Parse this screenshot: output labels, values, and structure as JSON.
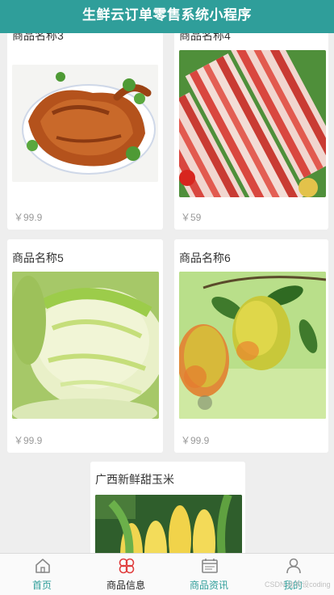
{
  "header": {
    "title": "生鲜云订单零售系统小程序"
  },
  "products": [
    {
      "name": "商品名称3",
      "price": "￥99.9",
      "image": "roast-chicken"
    },
    {
      "name": "商品名称4",
      "price": "￥59",
      "image": "pork-belly"
    },
    {
      "name": "商品名称5",
      "price": "￥99.9",
      "image": "napa-cabbage"
    },
    {
      "name": "商品名称6",
      "price": "￥99.9",
      "image": "mango"
    },
    {
      "name": "广西新鲜甜玉米",
      "image": "corn"
    }
  ],
  "tabbar": {
    "items": [
      {
        "label": "首页",
        "icon": "home-icon"
      },
      {
        "label": "商品信息",
        "icon": "clover-icon"
      },
      {
        "label": "商品资讯",
        "icon": "calendar-icon"
      },
      {
        "label": "我的",
        "icon": "user-icon"
      }
    ]
  },
  "watermark": "CSDN @毕设coding",
  "colors": {
    "header": "#2f9e9a",
    "tab_active": "#2f9e9a",
    "price": "#999999"
  }
}
